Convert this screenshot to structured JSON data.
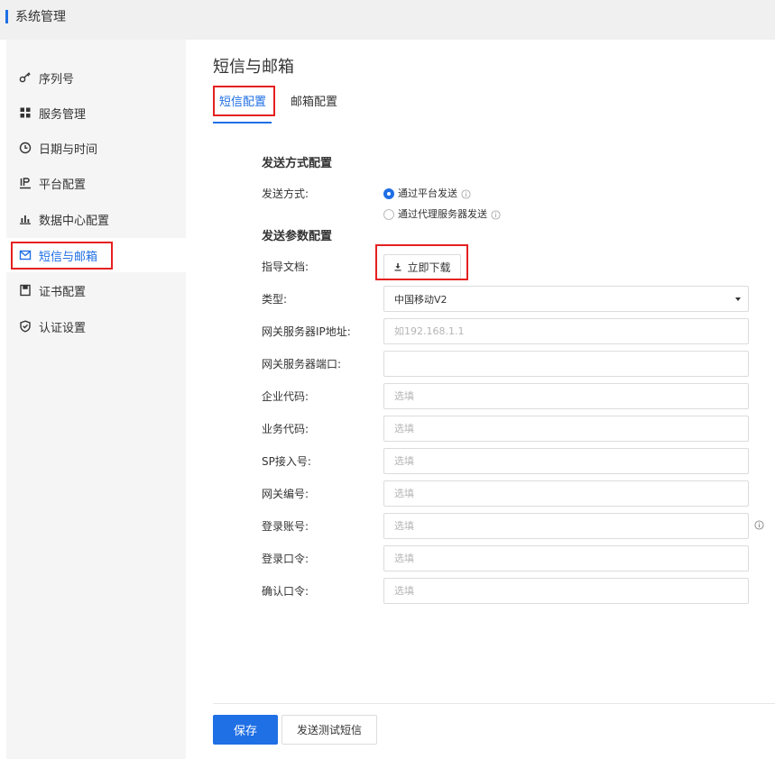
{
  "window": {
    "title": "系统管理"
  },
  "sidebar": {
    "items": [
      {
        "label": "序列号",
        "icon": "key-icon",
        "active": false
      },
      {
        "label": "服务管理",
        "icon": "grid-icon",
        "active": false
      },
      {
        "label": "日期与时间",
        "icon": "clock-icon",
        "active": false
      },
      {
        "label": "平台配置",
        "icon": "ip-icon",
        "active": false
      },
      {
        "label": "数据中心配置",
        "icon": "bar-chart-icon",
        "active": false
      },
      {
        "label": "短信与邮箱",
        "icon": "mail-icon",
        "active": true
      },
      {
        "label": "证书配置",
        "icon": "save-icon",
        "active": false
      },
      {
        "label": "认证设置",
        "icon": "shield-icon",
        "active": false
      }
    ]
  },
  "main": {
    "title": "短信与邮箱",
    "tabs": [
      {
        "label": "短信配置",
        "active": true
      },
      {
        "label": "邮箱配置",
        "active": false
      }
    ],
    "send_method": {
      "section_title": "发送方式配置",
      "label": "发送方式:",
      "options": [
        {
          "label": "通过平台发送",
          "checked": true,
          "icon": "info-icon"
        },
        {
          "label": "通过代理服务器发送",
          "checked": false,
          "icon": "info-icon"
        }
      ]
    },
    "params": {
      "section_title": "发送参数配置",
      "guide_label": "指导文档:",
      "download_label": "立即下载",
      "download_icon": "download-icon",
      "type_label": "类型:",
      "type_value": "中国移动V2",
      "fields": [
        {
          "label": "网关服务器IP地址:",
          "placeholder": "如192.168.1.1",
          "value": ""
        },
        {
          "label": "网关服务器端口:",
          "placeholder": "",
          "value": ""
        },
        {
          "label": "企业代码:",
          "placeholder": "选填",
          "value": ""
        },
        {
          "label": "业务代码:",
          "placeholder": "选填",
          "value": ""
        },
        {
          "label": "SP接入号:",
          "placeholder": "选填",
          "value": ""
        },
        {
          "label": "网关编号:",
          "placeholder": "选填",
          "value": ""
        },
        {
          "label": "登录账号:",
          "placeholder": "选填",
          "value": ""
        },
        {
          "label": "登录口令:",
          "placeholder": "选填",
          "value": ""
        },
        {
          "label": "确认口令:",
          "placeholder": "选填",
          "value": ""
        }
      ]
    },
    "footer": {
      "save_label": "保存",
      "test_label": "发送测试短信"
    }
  },
  "colors": {
    "accent": "#1f6fe5",
    "highlight": "#e52020"
  }
}
